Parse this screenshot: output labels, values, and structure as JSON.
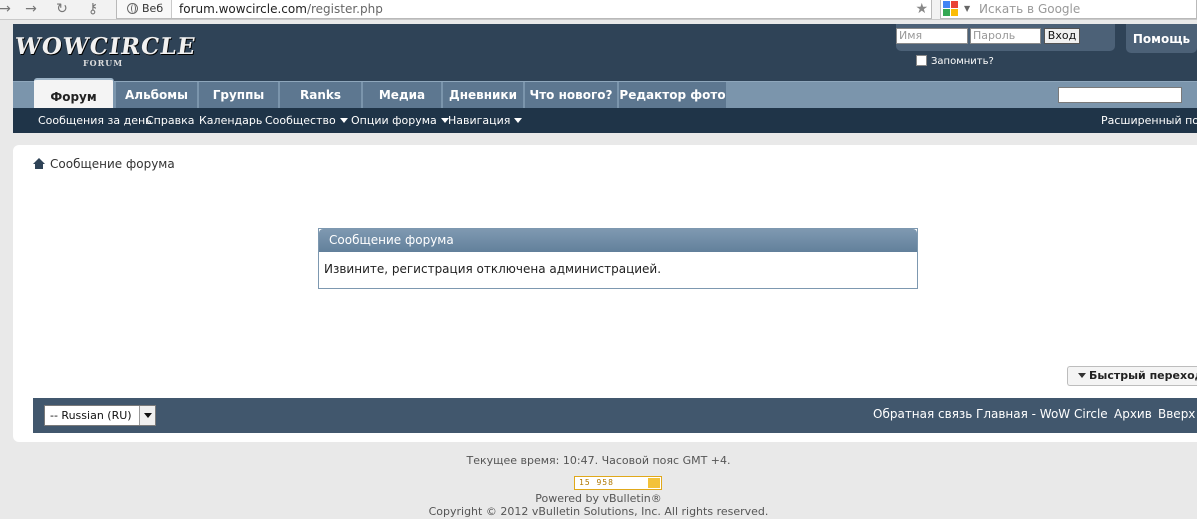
{
  "browser": {
    "web_label": "Веб",
    "url_host": "forum.wowcircle.com",
    "url_path": "/register.php",
    "search_placeholder": "Искать в Google"
  },
  "header": {
    "logo": "WOWCIRCLE",
    "logo_sub": "FORUM",
    "login_placeholder": "Имя",
    "password_placeholder": "Пароль",
    "login_button": "Вход",
    "remember_label": "Запомнить?",
    "help_button": "Помощь"
  },
  "nav": {
    "tabs": [
      {
        "label": "Форум",
        "active": true
      },
      {
        "label": "Альбомы"
      },
      {
        "label": "Группы"
      },
      {
        "label": "Ranks"
      },
      {
        "label": "Медиа"
      },
      {
        "label": "Дневники"
      },
      {
        "label": "Что нового?"
      },
      {
        "label": "Редактор фото"
      }
    ]
  },
  "subnav": {
    "items": [
      {
        "label": "Сообщения за день"
      },
      {
        "label": "Справка"
      },
      {
        "label": "Календарь"
      },
      {
        "label": "Сообщество"
      },
      {
        "label": "Опции форума"
      },
      {
        "label": "Навигация"
      }
    ],
    "advanced_search": "Расширенный поиск"
  },
  "content": {
    "breadcrumb": "Сообщение форума",
    "message_title": "Сообщение форума",
    "message_body": "Извините, регистрация отключена администрацией.",
    "quick_jump": "Быстрый переход"
  },
  "footer": {
    "language": "-- Russian (RU)",
    "links": [
      {
        "label": "Обратная связь"
      },
      {
        "label": "Главная - WoW Circle"
      },
      {
        "label": "Архив"
      },
      {
        "label": "Вверх"
      }
    ]
  },
  "bottom": {
    "time_prefix": "Текущее время:",
    "time_value": "10:47",
    "timezone": ". Часовой пояс GMT +4.",
    "counter": "15 958",
    "powered_by": "Powered by vBulletin®",
    "copyright": "Copyright © 2012 vBulletin Solutions, Inc. All rights reserved."
  }
}
